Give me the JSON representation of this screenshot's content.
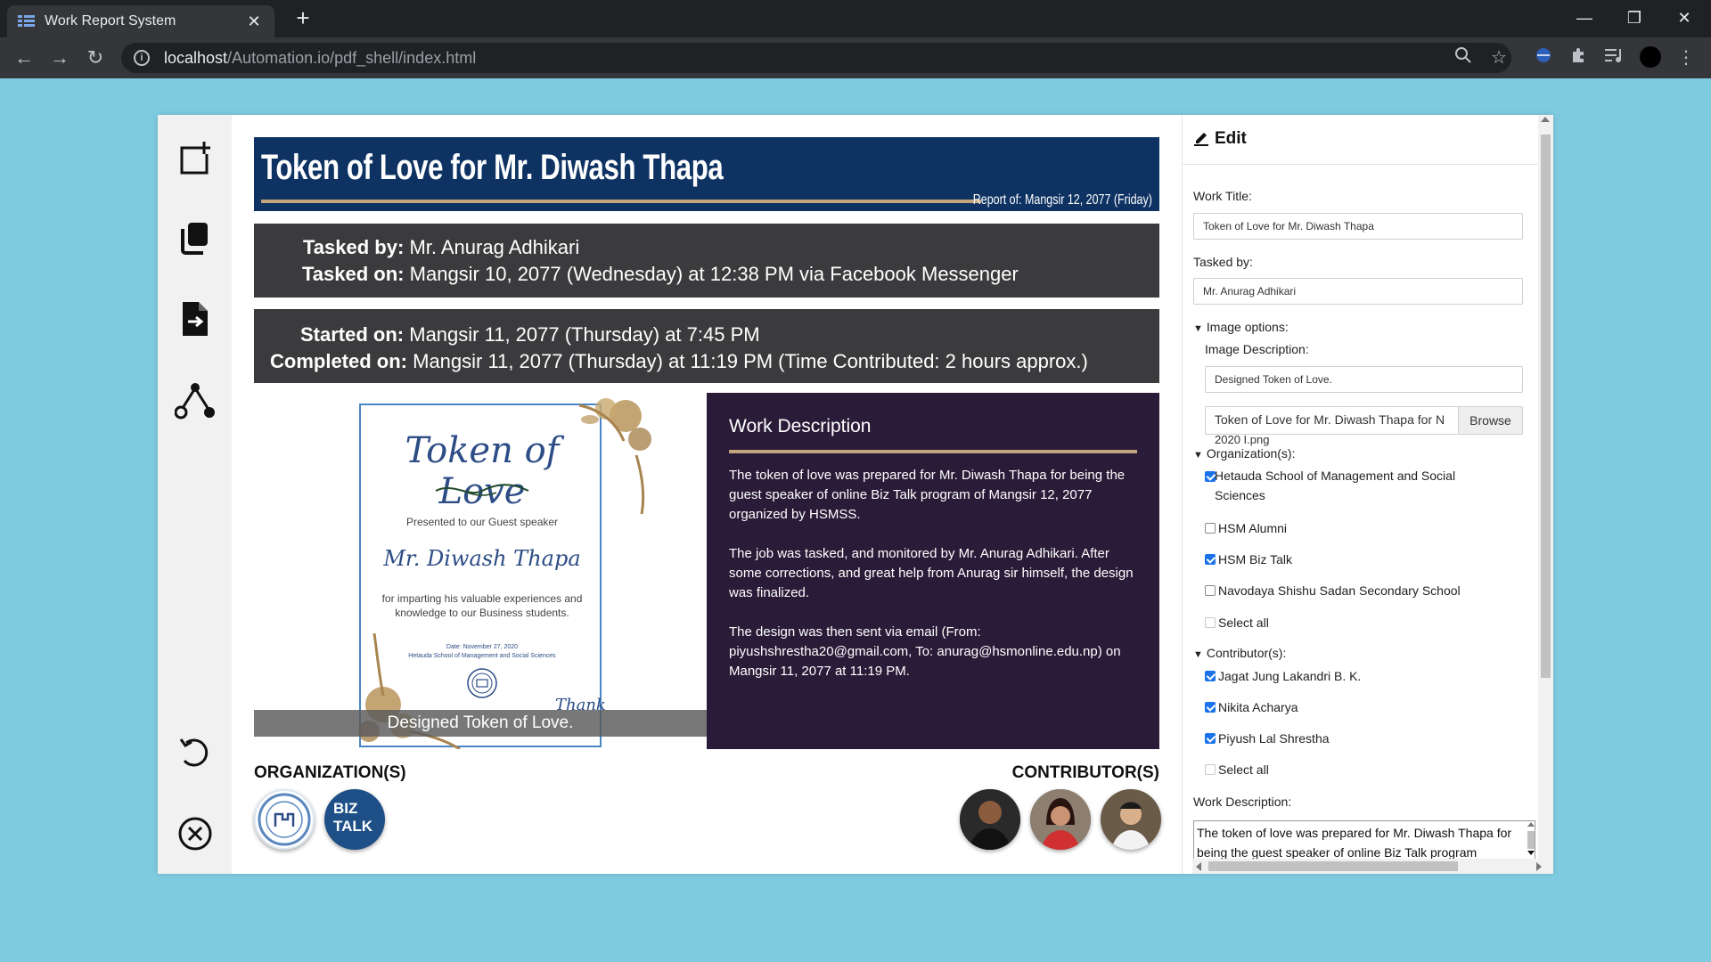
{
  "browser": {
    "tab_title": "Work Report System",
    "tab_close": "✕",
    "new_tab": "+",
    "url_host": "localhost",
    "url_path": "/Automation.io/pdf_shell/index.html",
    "win_minimize": "—",
    "win_restore": "❐",
    "win_close": "✕",
    "back": "←",
    "forward": "→",
    "reload": "↻"
  },
  "sidebar": {
    "icons": [
      "add-page-icon",
      "copy-icon",
      "export-document-icon",
      "share-icon",
      "undo-icon",
      "close-circle-icon"
    ]
  },
  "report": {
    "title": "Token of Love for Mr. Diwash Thapa",
    "report_date": "Report of: Mangsir 12, 2077 (Friday)",
    "tasked_by_label": "Tasked by:",
    "tasked_by_value": "Mr. Anurag Adhikari",
    "tasked_on_label": "Tasked on:",
    "tasked_on_value": "Mangsir 10, 2077 (Wednesday) at 12:38 PM via Facebook Messenger",
    "started_label": "Started on:",
    "started_value": "Mangsir 11, 2077 (Thursday) at 7:45 PM",
    "completed_label": "Completed on:",
    "completed_value": "Mangsir 11, 2077 (Thursday) at 11:19 PM (Time Contributed: 2 hours approx.)",
    "image_caption": "Designed Token of Love.",
    "certificate": {
      "heading": "Token of Love",
      "presented": "Presented to our Guest speaker",
      "name": "Mr. Diwash Thapa",
      "line1": "for imparting his valuable experiences and",
      "line2": "knowledge to our Business students.",
      "date": "Date: November 27, 2020",
      "school": "Hetauda School of Management and Social Sciences",
      "thank": "Thank"
    },
    "description_title": "Work Description",
    "description_paragraphs": [
      "The token of love was prepared for Mr. Diwash Thapa for being the guest speaker of online Biz Talk program of Mangsir 12, 2077 organized by HSMSS.",
      "The job was tasked, and monitored by Mr. Anurag Adhikari. After some corrections, and great help from Anurag sir himself, the design was finalized.",
      "The design was then sent via email (From: piyushshrestha20@gmail.com, To: anurag@hsmonline.edu.np) on Mangsir 11, 2077 at 11:19 PM."
    ],
    "organizations_label": "ORGANIZATION(S)",
    "contributors_label": "CONTRIBUTOR(S)",
    "biz_talk_line1": "BIZ",
    "biz_talk_line2": "TALK"
  },
  "edit": {
    "title": "Edit",
    "work_title_label": "Work Title:",
    "work_title_value": "Token of Love for Mr. Diwash Thapa",
    "tasked_by_label": "Tasked by:",
    "tasked_by_value": "Mr. Anurag Adhikari",
    "image_options_label": "Image options:",
    "image_description_label": "Image Description:",
    "image_description_value": "Designed Token of Love.",
    "file_name": "Token of Love for Mr. Diwash Thapa for N",
    "file_name_cont": "2020 I.png",
    "browse_label": "Browse",
    "organizations_label": "Organization(s):",
    "organizations": [
      {
        "label": "Hetauda School of Management and Social Sciences",
        "checked": true
      },
      {
        "label": "HSM Alumni",
        "checked": false
      },
      {
        "label": "HSM Biz Talk",
        "checked": true
      },
      {
        "label": "Navodaya Shishu Sadan Secondary School",
        "checked": false
      }
    ],
    "org_select_all": "Select all",
    "contributors_label": "Contributor(s):",
    "contributors": [
      {
        "label": "Jagat Jung Lakandri B. K.",
        "checked": true
      },
      {
        "label": "Nikita Acharya",
        "checked": true
      },
      {
        "label": "Piyush Lal Shrestha",
        "checked": true
      }
    ],
    "con_select_all": "Select all",
    "work_description_label": "Work Description:",
    "work_description_value": "The token of love was prepared for Mr. Diwash Thapa for being the guest speaker of online Biz Talk program"
  },
  "colors": {
    "page_bg": "#7ecbe0",
    "title_bar": "#0e3363",
    "info_box": "#3b3a3d",
    "desc_panel": "#2a1b38",
    "accent_line": "#c2a47d"
  }
}
